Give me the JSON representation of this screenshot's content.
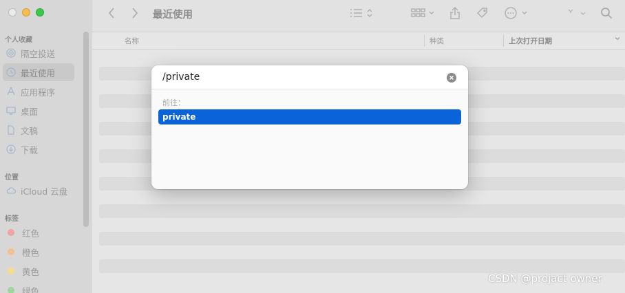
{
  "window": {
    "title": "最近使用"
  },
  "sidebar": {
    "favorites_header": "个人收藏",
    "favorites": [
      {
        "label": "隔空投送",
        "icon": "airdrop-icon"
      },
      {
        "label": "最近使用",
        "icon": "clock-icon",
        "active": true
      },
      {
        "label": "应用程序",
        "icon": "applications-icon"
      },
      {
        "label": "桌面",
        "icon": "desktop-icon"
      },
      {
        "label": "文稿",
        "icon": "document-icon"
      },
      {
        "label": "下载",
        "icon": "download-icon"
      }
    ],
    "locations_header": "位置",
    "locations": [
      {
        "label": "iCloud 云盘",
        "icon": "cloud-icon"
      }
    ],
    "tags_header": "标签",
    "tags": [
      {
        "label": "红色",
        "color": "#f2a3a3"
      },
      {
        "label": "橙色",
        "color": "#f4c18e"
      },
      {
        "label": "黄色",
        "color": "#f3dc8a"
      },
      {
        "label": "绿色",
        "color": "#9fd6a0"
      }
    ]
  },
  "columns": {
    "name": "名称",
    "kind": "种类",
    "last_opened": "上次打开日期"
  },
  "goto_dialog": {
    "input_value": "/private",
    "goto_label": "前往：",
    "suggestions": [
      "private"
    ]
  },
  "watermark": "CSDN @projact owner"
}
